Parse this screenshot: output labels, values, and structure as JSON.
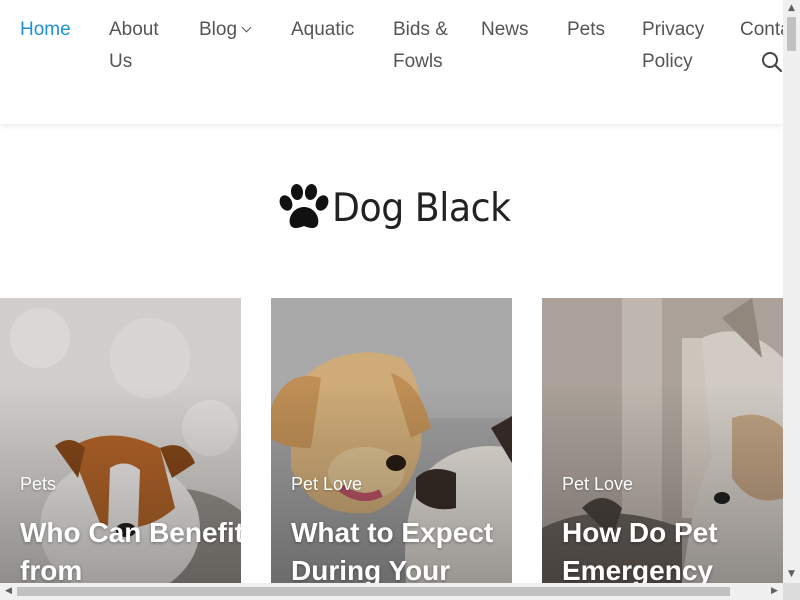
{
  "nav": {
    "items": [
      {
        "label": "Home",
        "active": true
      },
      {
        "label": "About Us"
      },
      {
        "label": "Blog",
        "has_dropdown": true
      },
      {
        "label": "Aquatic"
      },
      {
        "label": "Bids & Fowls"
      },
      {
        "label": "News"
      },
      {
        "label": "Pets"
      },
      {
        "label": "Privacy Policy"
      },
      {
        "label": "Contact"
      }
    ],
    "active_color": "#1e90d6",
    "text_color": "#555555",
    "search_icon": "search-icon"
  },
  "logo": {
    "text": "Dog Black",
    "icon": "paw-icon"
  },
  "posts": [
    {
      "category": "Pets",
      "title": "Who Can Benefit from",
      "image": "dog-on-blanket-photo"
    },
    {
      "category": "Pet Love",
      "title": "What to Expect During Your",
      "image": "puppy-and-kitten-photo"
    },
    {
      "category": "Pet Love",
      "title": "How Do Pet Emergency",
      "image": "husky-and-cat-photo"
    }
  ],
  "scrollbars": {
    "up_arrow": "▲",
    "down_arrow": "▼",
    "left_arrow": "◀",
    "right_arrow": "▶"
  }
}
